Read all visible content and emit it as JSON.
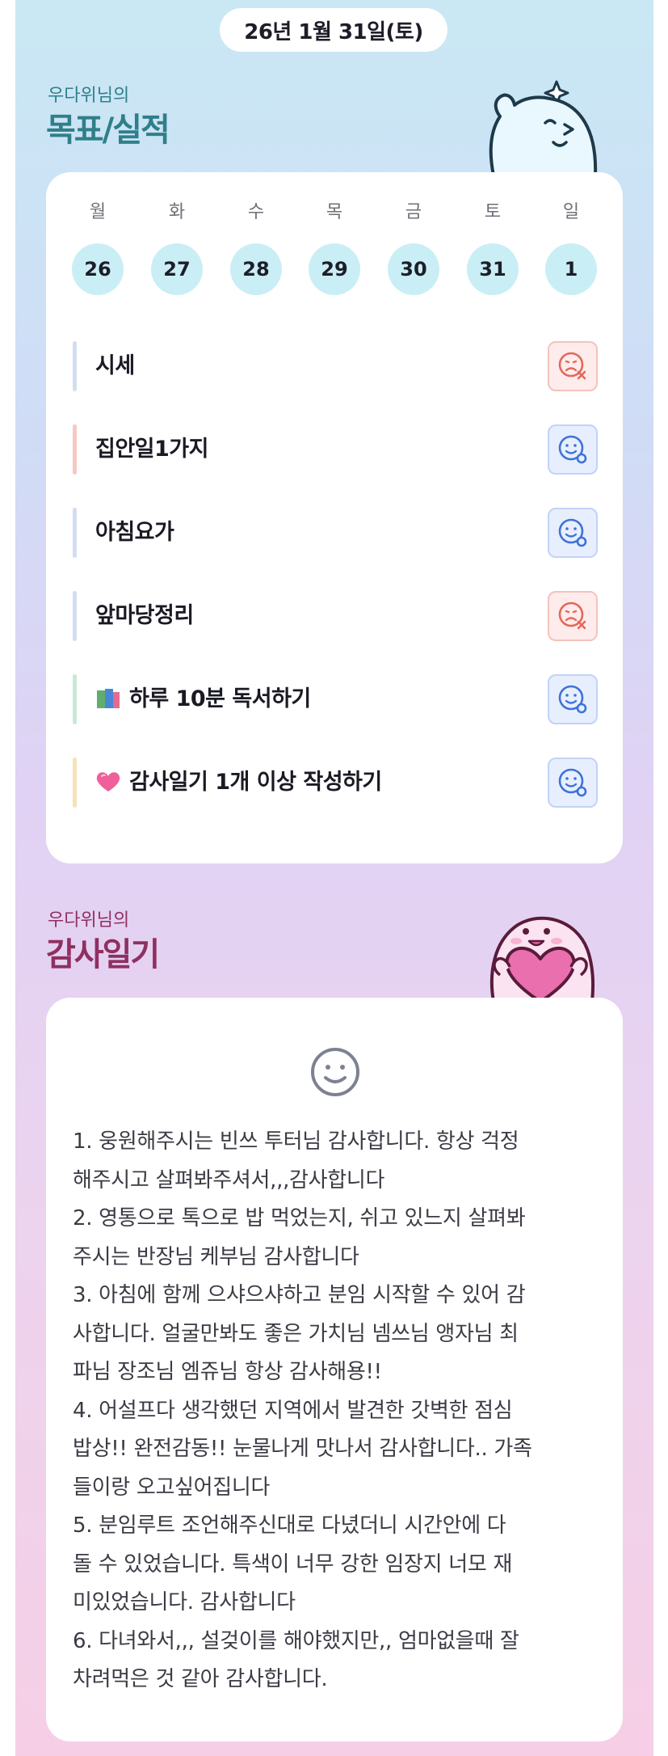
{
  "header": {
    "date": "26년 1월 31일(토)"
  },
  "goals_section": {
    "subtitle": "우다위님의",
    "title": "목표/실적"
  },
  "week": [
    {
      "day": "월",
      "date": "26"
    },
    {
      "day": "화",
      "date": "27"
    },
    {
      "day": "수",
      "date": "28"
    },
    {
      "day": "목",
      "date": "29"
    },
    {
      "day": "금",
      "date": "30"
    },
    {
      "day": "토",
      "date": "31"
    },
    {
      "day": "일",
      "date": "1"
    }
  ],
  "goals": [
    {
      "label": "시세",
      "status": "fail",
      "accent": "#d3ddf1",
      "icon": ""
    },
    {
      "label": "집안일1가지",
      "status": "success",
      "accent": "#f4c9c2",
      "icon": ""
    },
    {
      "label": "아침요가",
      "status": "success",
      "accent": "#d3ddf1",
      "icon": ""
    },
    {
      "label": "앞마당정리",
      "status": "fail",
      "accent": "#d3ddf1",
      "icon": ""
    },
    {
      "label": "하루 10분 독서하기",
      "status": "success",
      "accent": "#c6ead4",
      "icon": "books-icon"
    },
    {
      "label": "감사일기 1개 이상 작성하기",
      "status": "success",
      "accent": "#f7e2b8",
      "icon": "heart-icon"
    }
  ],
  "gratitude_section": {
    "subtitle": "우다위님의",
    "title": "감사일기"
  },
  "diary": {
    "lines": [
      "1. 웅원해주시는 빈쓰 투터님 감사합니다. 항상 걱정",
      "해주시고 살펴봐주셔서,,,감사합니다",
      "2. 영통으로 톡으로 밥 먹었는지, 쉬고 있느지 살펴봐",
      "주시는 반장님 케부님 감사합니다",
      "3. 아침에 함께 으샤으샤하고 분임 시작할 수 있어 감",
      "사합니다. 얼굴만봐도 좋은 가치님 넴쓰님 앵자님 최",
      "파님 장조님 엠쥬님 항상 감사해용!!",
      "4. 어설프다 생각했던 지역에서 발견한 갓벽한 점심",
      "밥상!! 완전감동!! 눈물나게 맛나서 감사합니다.. 가족",
      "들이랑 오고싶어집니다",
      "5. 분임루트 조언해주신대로 다녔더니 시간안에 다",
      "돌 수 있었습니다. 특색이 너무 강한 임장지 너모 재",
      "미있었습니다. 감사합니다",
      "6. 다녀와서,,, 설겆이를 해야했지만,, 엄마없을때 잘",
      "차려먹은 것 같아 감사합니다."
    ]
  },
  "colors": {
    "goals_title": "#2f7f8a",
    "gratitude_title": "#8f3061",
    "fail": "#e4685a",
    "success": "#3f72d8"
  }
}
